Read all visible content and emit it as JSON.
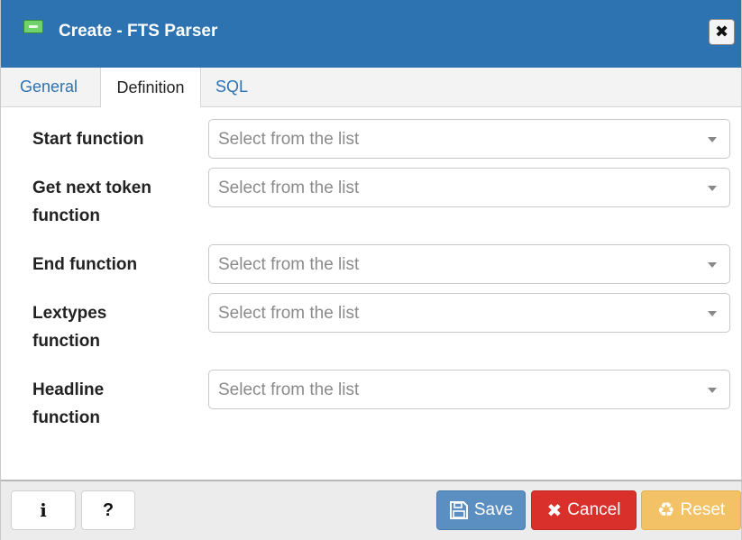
{
  "dialog": {
    "title": "Create - FTS Parser",
    "close_symbol": "✖"
  },
  "tabs": [
    {
      "label": "General"
    },
    {
      "label": "Definition"
    },
    {
      "label": "SQL"
    }
  ],
  "active_tab": "Definition",
  "fields": [
    {
      "label_lines": [
        "Start function"
      ],
      "placeholder": "Select from the list"
    },
    {
      "label_lines": [
        "Get next token",
        "function"
      ],
      "placeholder": "Select from the list"
    },
    {
      "label_lines": [
        "End function"
      ],
      "placeholder": "Select from the list"
    },
    {
      "label_lines": [
        "Lextypes",
        "function"
      ],
      "placeholder": "Select from the list"
    },
    {
      "label_lines": [
        "Headline",
        "function"
      ],
      "placeholder": "Select from the list"
    }
  ],
  "footer": {
    "info_label": "i",
    "help_label": "?",
    "save_label": "Save",
    "cancel_label": "Cancel",
    "reset_label": "Reset"
  },
  "colors": {
    "header_blue": "#2d72b1",
    "save_blue": "#5b8fc2",
    "cancel_red": "#d9302c",
    "reset_orange": "#f3c266"
  }
}
